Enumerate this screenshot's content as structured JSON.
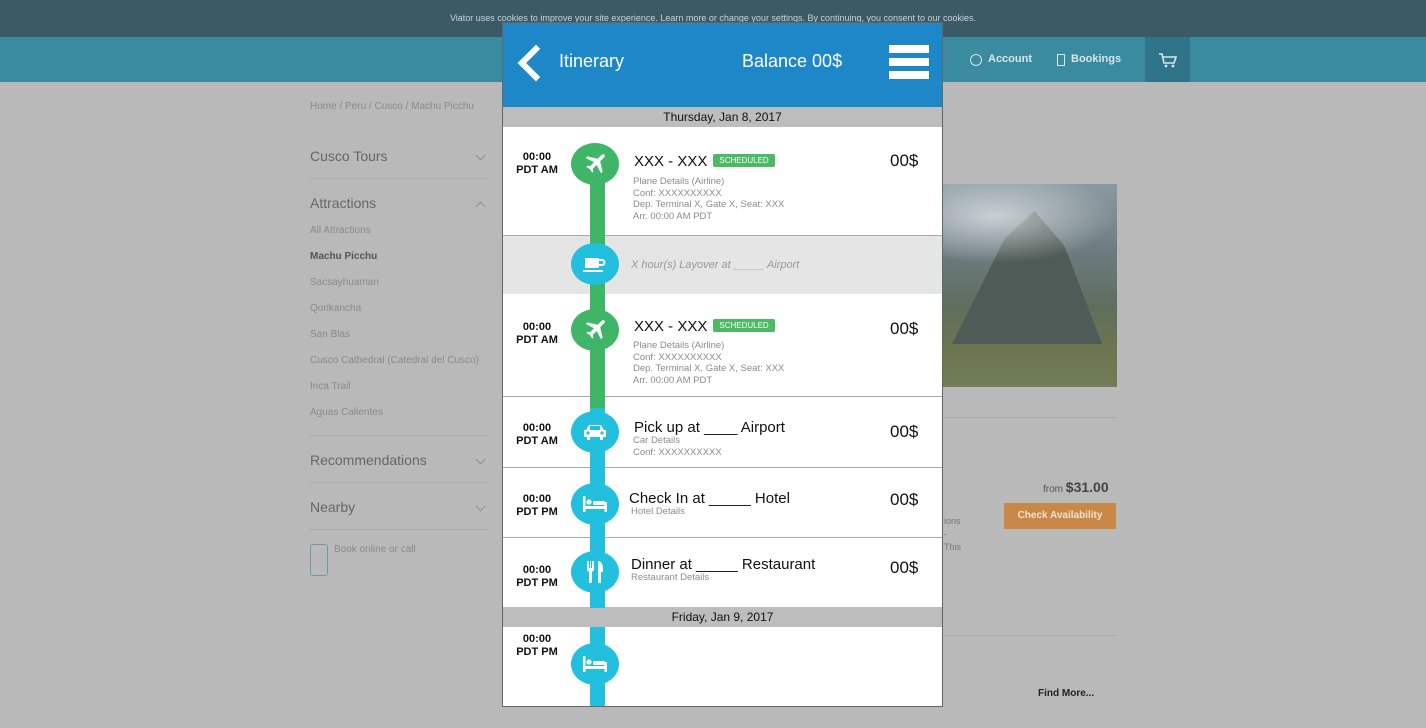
{
  "cookie_notice": "Viator uses cookies to improve your site experience. Learn more or change your settings. By continuing, you consent to our cookies.",
  "nav": {
    "account": "Account",
    "bookings": "Bookings"
  },
  "breadcrumb": "Home / Peru / Cusco / Machu Picchu",
  "sidebar": {
    "sections": [
      {
        "title": "Cusco Tours"
      },
      {
        "title": "Attractions"
      },
      {
        "title": "Recommendations"
      },
      {
        "title": "Nearby"
      }
    ],
    "attractions": [
      "All Attractions",
      "Machu Picchu",
      "Sacsayhuaman",
      "Qorikancha",
      "San Blas",
      "Cusco Cathedral (Catedral del Cusco)",
      "Inca Trail",
      "Aguas Calientes"
    ],
    "book_call": "Book online or call"
  },
  "product": {
    "from_label": "from",
    "price": "$31.00",
    "check_availability": "Check Availability",
    "fragments": [
      "ions",
      "-",
      "This"
    ],
    "find_more": "Find More..."
  },
  "itinerary": {
    "title": "Itinerary",
    "balance": "Balance 00$",
    "days": [
      "Thursday, Jan 8, 2017",
      "Friday, Jan 9, 2017"
    ],
    "events": [
      {
        "time1": "00:00",
        "time2": "PDT AM",
        "title": "XXX - XXX",
        "badge": "SCHEDULED",
        "price": "00$",
        "details": [
          "Plane Details (Airline)",
          "Conf: XXXXXXXXXX",
          "Dep. Terminal X, Gate X, Seat: XXX",
          "Arr. 00:00 AM PDT"
        ],
        "icon": "airplane-icon"
      },
      {
        "layover": "X hour(s) Layover at _____ Airport",
        "icon": "coffee-cup-icon"
      },
      {
        "time1": "00:00",
        "time2": "PDT AM",
        "title": "XXX - XXX",
        "badge": "SCHEDULED",
        "price": "00$",
        "details": [
          "Plane Details (Airline)",
          "Conf: XXXXXXXXXX",
          "Dep. Terminal X, Gate X, Seat: XXX",
          "Arr. 00:00 AM PDT"
        ],
        "icon": "airplane-icon"
      },
      {
        "time1": "00:00",
        "time2": "PDT AM",
        "title": "Pick up at ____ Airport",
        "price": "00$",
        "details": [
          "Car Details",
          "Conf: XXXXXXXXXX"
        ],
        "icon": "car-icon"
      },
      {
        "time1": "00:00",
        "time2": "PDT PM",
        "title": "Check In at _____ Hotel",
        "price": "00$",
        "details": [
          "Hotel Details"
        ],
        "icon": "bed-icon"
      },
      {
        "time1": "00:00",
        "time2": "PDT PM",
        "title": "Dinner at _____ Restaurant",
        "price": "00$",
        "details": [
          "Restaurant Details"
        ],
        "icon": "fork-knife-icon"
      },
      {
        "time1": "00:00",
        "time2": "PDT PM",
        "icon": "bed-icon"
      }
    ]
  },
  "colors": {
    "header_blue": "#1e87c8",
    "rail_green": "#3eb567",
    "rail_cyan": "#22c0de",
    "badge_green": "#4cb963"
  }
}
